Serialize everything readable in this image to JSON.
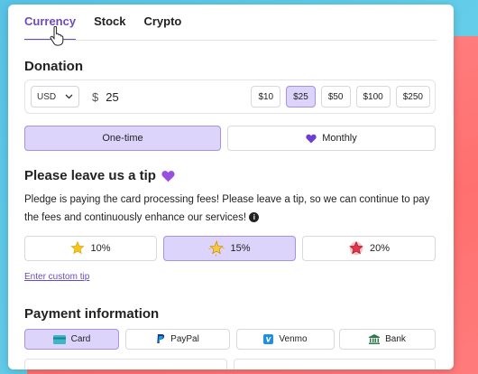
{
  "tabs": [
    {
      "label": "Currency",
      "active": true
    },
    {
      "label": "Stock",
      "active": false
    },
    {
      "label": "Crypto",
      "active": false
    }
  ],
  "donation": {
    "title": "Donation",
    "currency": "USD",
    "currency_symbol": "$",
    "amount": "25",
    "presets": [
      "$10",
      "$25",
      "$50",
      "$100",
      "$250"
    ],
    "selected_preset": "$25"
  },
  "frequency": {
    "one_time": "One-time",
    "monthly": "Monthly",
    "selected": "One-time"
  },
  "tip": {
    "title": "Please leave us a tip",
    "description": "Pledge is paying the card processing fees! Please leave a tip, so we can continue to pay the fees and continuously enhance our services!",
    "options": [
      "10%",
      "15%",
      "20%"
    ],
    "selected": "15%",
    "custom_link": "Enter custom tip"
  },
  "payment": {
    "title": "Payment information",
    "methods": [
      "Card",
      "PayPal",
      "Venmo",
      "Bank"
    ],
    "selected": "Card"
  },
  "colors": {
    "accent": "#6a4cc0",
    "selected_bg": "#ddd4fb",
    "background_blue": "#5fcbe8",
    "background_red": "#ff7575"
  }
}
